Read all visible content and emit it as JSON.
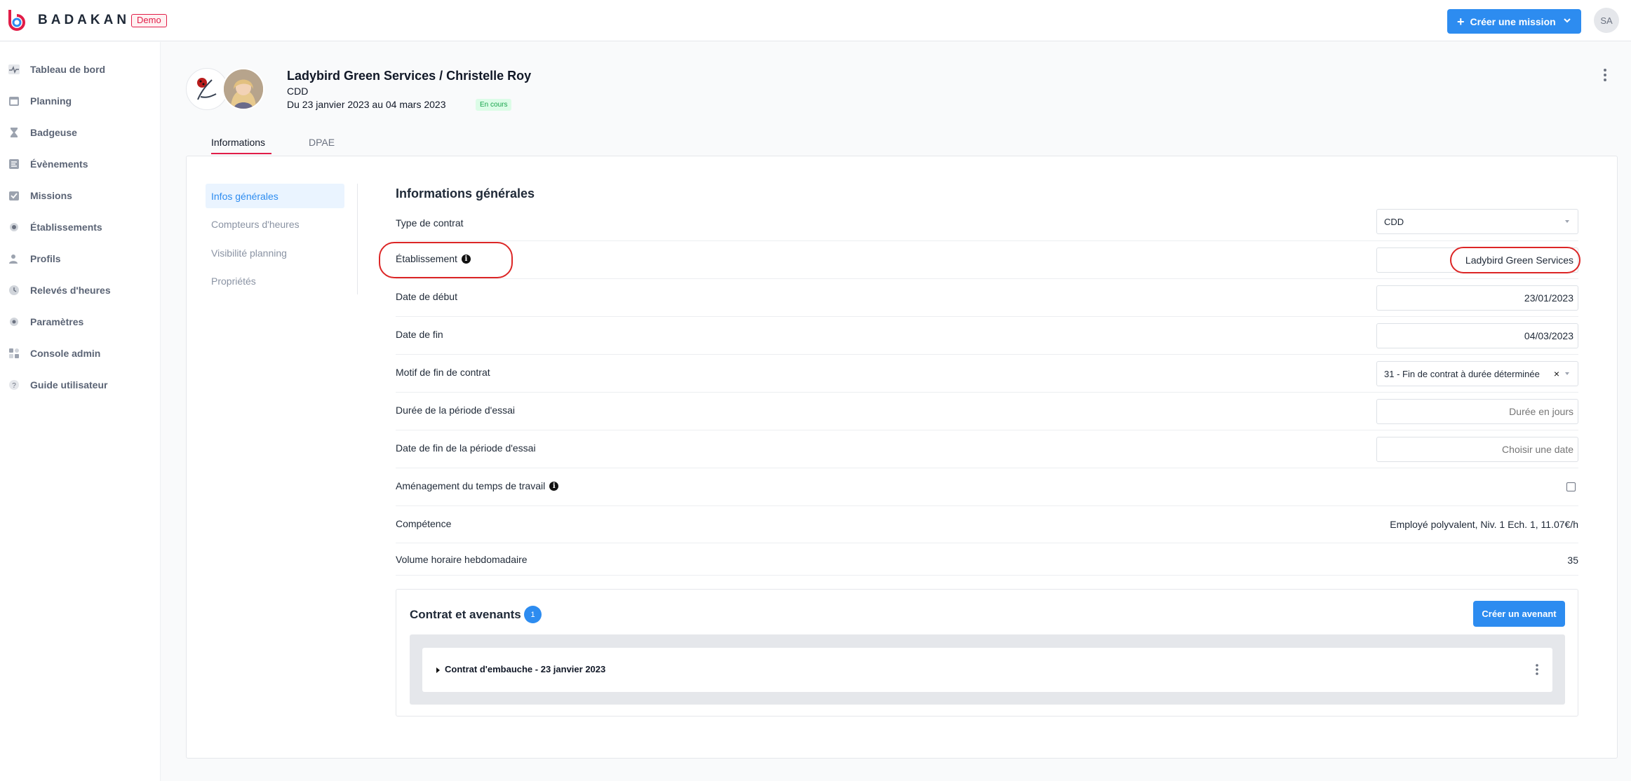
{
  "brand": {
    "name": "BADAKAN",
    "badge": "Demo"
  },
  "topbar": {
    "create_mission_label": "Créer une mission",
    "user_initials": "SA"
  },
  "sidebar": {
    "items": [
      {
        "label": "Tableau de bord",
        "icon": "pulse-icon"
      },
      {
        "label": "Planning",
        "icon": "calendar-icon"
      },
      {
        "label": "Badgeuse",
        "icon": "hourglass-icon"
      },
      {
        "label": "Évènements",
        "icon": "list-icon"
      },
      {
        "label": "Missions",
        "icon": "check-calendar-icon"
      },
      {
        "label": "Établissements",
        "icon": "building-icon"
      },
      {
        "label": "Profils",
        "icon": "users-icon"
      },
      {
        "label": "Relevés d'heures",
        "icon": "clock-icon"
      },
      {
        "label": "Paramètres",
        "icon": "gear-icon"
      },
      {
        "label": "Console admin",
        "icon": "grid-icon"
      },
      {
        "label": "Guide utilisateur",
        "icon": "help-icon"
      }
    ]
  },
  "header": {
    "title": "Ladybird Green Services / Christelle Roy",
    "contract_type": "CDD",
    "dates": "Du 23 janvier 2023 au 04 mars 2023",
    "status": "En cours"
  },
  "tabs": [
    {
      "label": "Informations",
      "active": true
    },
    {
      "label": "DPAE",
      "active": false
    }
  ],
  "subnav": [
    {
      "label": "Infos générales",
      "active": true
    },
    {
      "label": "Compteurs d'heures",
      "active": false
    },
    {
      "label": "Visibilité planning",
      "active": false
    },
    {
      "label": "Propriétés",
      "active": false
    }
  ],
  "section": {
    "title": "Informations générales",
    "rows": {
      "contract_type": {
        "label": "Type de contrat",
        "value": "CDD"
      },
      "establishment": {
        "label": "Établissement",
        "value": "Ladybird Green Services"
      },
      "start_date": {
        "label": "Date de début",
        "value": "23/01/2023"
      },
      "end_date": {
        "label": "Date de fin",
        "value": "04/03/2023"
      },
      "end_reason": {
        "label": "Motif de fin de contrat",
        "value": "31 - Fin de contrat à durée déterminée"
      },
      "trial_duration": {
        "label": "Durée de la période d'essai",
        "placeholder": "Durée en jours"
      },
      "trial_end": {
        "label": "Date de fin de la période d'essai",
        "placeholder": "Choisir une date"
      },
      "work_time": {
        "label": "Aménagement du temps de travail",
        "checked": false
      },
      "competence": {
        "label": "Compétence",
        "value": "Employé polyvalent, Niv. 1 Ech. 1, 11.07€/h"
      },
      "weekly_volume": {
        "label": "Volume horaire hebdomadaire",
        "value": "35"
      }
    }
  },
  "contracts": {
    "title": "Contrat et avenants",
    "count": "1",
    "create_label": "Créer un avenant",
    "items": [
      {
        "label": "Contrat d'embauche - 23 janvier 2023"
      }
    ]
  },
  "colors": {
    "accent": "#2d8cf0",
    "brand_red": "#e11d48",
    "highlight": "#dc2626",
    "status_green": "#16a34a"
  }
}
